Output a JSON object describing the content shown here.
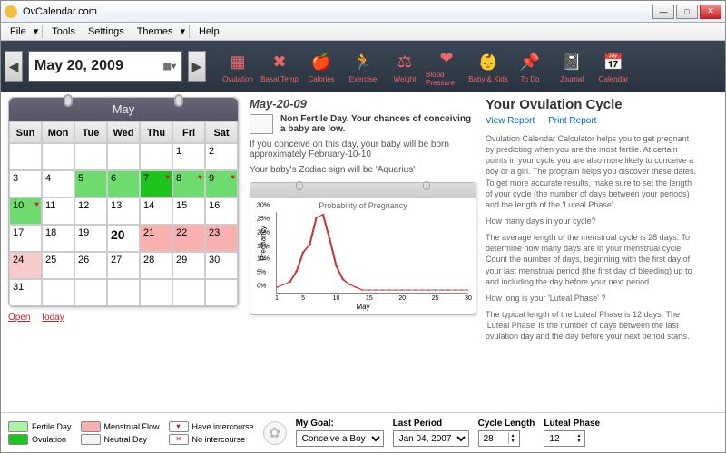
{
  "window": {
    "title": "OvCalendar.com"
  },
  "menu": [
    "File",
    "Tools",
    "Settings",
    "Themes",
    "Help"
  ],
  "date_nav": {
    "display": "May    20, 2009"
  },
  "toolbar": [
    {
      "label": "Ovulation",
      "icon": "calendar-grid-icon"
    },
    {
      "label": "Basal Temp",
      "icon": "x-icon"
    },
    {
      "label": "Calories",
      "icon": "apples-icon"
    },
    {
      "label": "Exercise",
      "icon": "runner-icon"
    },
    {
      "label": "Weight",
      "icon": "scale-icon"
    },
    {
      "label": "Blood Pressure",
      "icon": "heart-pulse-icon"
    },
    {
      "label": "Baby & Kids",
      "icon": "baby-icon"
    },
    {
      "label": "To Do",
      "icon": "note-pin-icon"
    },
    {
      "label": "Journal",
      "icon": "notebook-icon"
    },
    {
      "label": "Calendar",
      "icon": "calendar-icon"
    }
  ],
  "calendar": {
    "month_label": "May",
    "day_headers": [
      "Sun",
      "Mon",
      "Tue",
      "Wed",
      "Thu",
      "Fri",
      "Sat"
    ],
    "cells": [
      {
        "n": "",
        "cls": ""
      },
      {
        "n": "",
        "cls": ""
      },
      {
        "n": "",
        "cls": ""
      },
      {
        "n": "",
        "cls": ""
      },
      {
        "n": "",
        "cls": ""
      },
      {
        "n": "1",
        "cls": ""
      },
      {
        "n": "2",
        "cls": ""
      },
      {
        "n": "3",
        "cls": ""
      },
      {
        "n": "4",
        "cls": ""
      },
      {
        "n": "5",
        "cls": "g1"
      },
      {
        "n": "6",
        "cls": "g1"
      },
      {
        "n": "7",
        "cls": "g2",
        "heart": true
      },
      {
        "n": "8",
        "cls": "g1",
        "heart": true
      },
      {
        "n": "9",
        "cls": "g1",
        "heart": true
      },
      {
        "n": "10",
        "cls": "g1",
        "heart": true
      },
      {
        "n": "11",
        "cls": ""
      },
      {
        "n": "12",
        "cls": ""
      },
      {
        "n": "13",
        "cls": ""
      },
      {
        "n": "14",
        "cls": ""
      },
      {
        "n": "15",
        "cls": ""
      },
      {
        "n": "16",
        "cls": ""
      },
      {
        "n": "17",
        "cls": ""
      },
      {
        "n": "18",
        "cls": ""
      },
      {
        "n": "19",
        "cls": ""
      },
      {
        "n": "20",
        "cls": "sel"
      },
      {
        "n": "21",
        "cls": "pk"
      },
      {
        "n": "22",
        "cls": "pk"
      },
      {
        "n": "23",
        "cls": "pk"
      },
      {
        "n": "24",
        "cls": "pk2"
      },
      {
        "n": "25",
        "cls": ""
      },
      {
        "n": "26",
        "cls": ""
      },
      {
        "n": "27",
        "cls": ""
      },
      {
        "n": "28",
        "cls": ""
      },
      {
        "n": "29",
        "cls": ""
      },
      {
        "n": "30",
        "cls": ""
      },
      {
        "n": "31",
        "cls": ""
      },
      {
        "n": "",
        "cls": ""
      },
      {
        "n": "",
        "cls": ""
      },
      {
        "n": "",
        "cls": ""
      },
      {
        "n": "",
        "cls": ""
      },
      {
        "n": "",
        "cls": ""
      },
      {
        "n": "",
        "cls": ""
      }
    ],
    "links": {
      "open": "Open",
      "today": "today"
    }
  },
  "day_panel": {
    "date_label": "May-20-09",
    "status_title": "Non Fertile Day. Your chances of conceiving a baby are low.",
    "line1": "If you conceive on this day, your baby will be born approximately February-10-10",
    "line2": "Your baby's Zodiac sign will be 'Aquarius'"
  },
  "chart_data": {
    "type": "line",
    "title": "Probability of Pregnancy",
    "xlabel": "May",
    "ylabel": "Pregnancy",
    "ylim": [
      0,
      30
    ],
    "y_ticks": [
      0,
      5,
      10,
      15,
      20,
      25,
      30
    ],
    "x": [
      1,
      2,
      3,
      4,
      5,
      6,
      7,
      8,
      9,
      10,
      11,
      12,
      13,
      14,
      15,
      16,
      17,
      18,
      19,
      20,
      21,
      22,
      23,
      24,
      25,
      26,
      27,
      28,
      29,
      30
    ],
    "values": [
      2,
      3,
      4,
      8,
      15,
      18,
      28,
      29,
      20,
      10,
      5,
      3,
      2,
      1,
      1,
      1,
      1,
      1,
      1,
      1,
      1,
      1,
      1,
      1,
      1,
      1,
      1,
      1,
      1,
      1
    ]
  },
  "info": {
    "heading": "Your Ovulation Cycle",
    "links": {
      "view": "View Report",
      "print": "Print Report"
    },
    "p1": "Ovulation Calendar Calculator helps you to get pregnant by predicting when you are the most fertile. At certain points in your cycle you are also more likely to conceive a boy or a girl. The program helps you discover these dates. To get more accurate results, make sure to set the length of your cycle (the number of days between your periods) and the length of the 'Luteal Phase'.",
    "q1": "How many days in your cycle?",
    "p2": "The average length of the menstrual cycle is 28 days. To determine how many days are in your menstrual cycle; Count the number of days, beginning with the first day of your last menstrual period (the first day of bleeding) up to and including the day before your next period.",
    "q2": "How long is your 'Luteal Phase' ?",
    "p3": "The typical length of the Luteal Phase is 12 days. The 'Luteal Phase' is the number of days between the last ovulation day and the day before your next period starts."
  },
  "legend": {
    "fertile": "Fertile Day",
    "menstrual": "Menstrual Flow",
    "have": "Have intercourse",
    "ovulation": "Ovulation",
    "neutral": "Neutral Day",
    "no": "No intercourse"
  },
  "footer": {
    "goal_label": "My Goal:",
    "goal_value": "Conceive a Boy",
    "last_period_label": "Last Period",
    "last_period_value": "Jan 04, 2007",
    "cycle_label": "Cycle Length",
    "cycle_value": "28",
    "luteal_label": "Luteal Phase",
    "luteal_value": "12"
  },
  "colors": {
    "fertile": "#a8f5a8",
    "ovulation": "#1ec41e",
    "menstrual": "#f8b0b0",
    "neutral": "#f4f4f4"
  }
}
